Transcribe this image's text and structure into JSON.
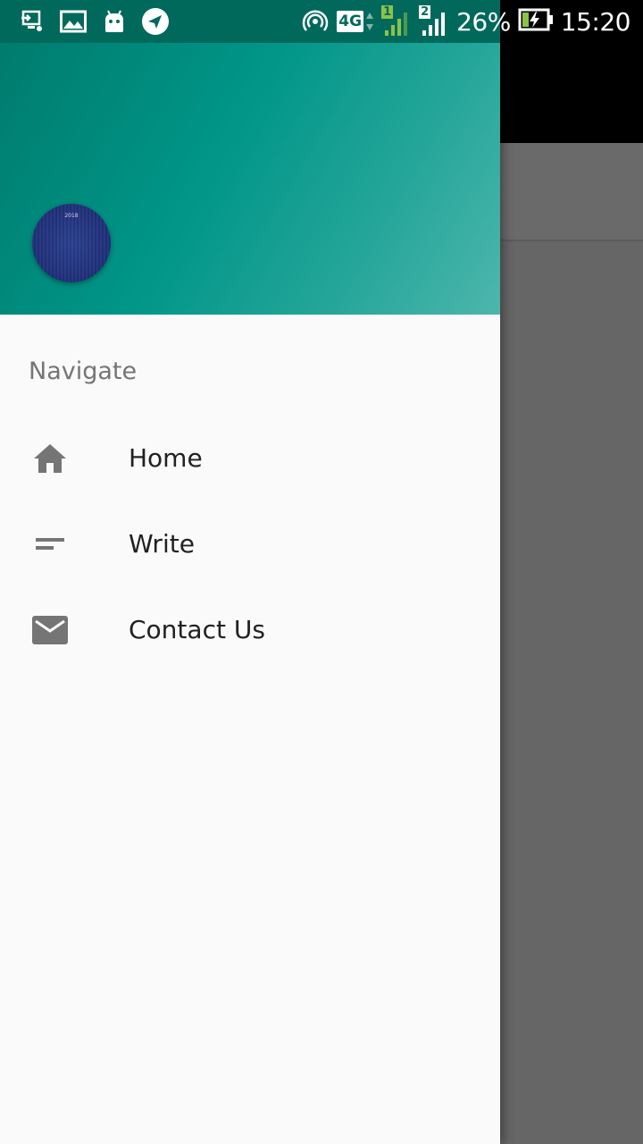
{
  "status_bar": {
    "notification_icons": [
      "screencast-icon",
      "image-icon",
      "android-icon",
      "send-icon"
    ],
    "network_label": "4G",
    "sim1_label": "1",
    "sim2_label": "2",
    "battery_percent": "26%",
    "time": "15:20",
    "battery_level": 0.26
  },
  "drawer": {
    "header": {
      "avatar_caption": "2018"
    },
    "section_title": "Navigate",
    "items": [
      {
        "label": "Home",
        "icon": "home-icon"
      },
      {
        "label": "Write",
        "icon": "short-text-icon"
      },
      {
        "label": "Contact Us",
        "icon": "mail-icon"
      }
    ]
  },
  "colors": {
    "header_gradient_start": "#00796b",
    "header_gradient_end": "#4db6ac",
    "status_bar": "#00695c",
    "scrim": "#666666",
    "icon_gray": "#757575",
    "text_primary": "#212121"
  }
}
